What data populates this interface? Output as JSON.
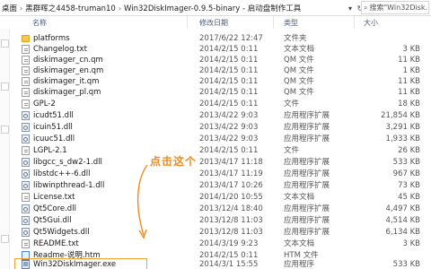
{
  "address_bar": {
    "segments": [
      "桌面",
      "黑群晖之4458-truman10",
      "Win32DiskImager-0.9.5-binary - 启动盘制作工具"
    ],
    "search_placeholder": "搜索\"Win32Disk..."
  },
  "columns": {
    "name": "名称",
    "date": "修改日期",
    "type": "类型",
    "size": "大小"
  },
  "files": [
    {
      "name": "platforms",
      "date": "2017/6/22 12:47",
      "type": "文件夹",
      "size": "",
      "icon": "folder-icon"
    },
    {
      "name": "Changelog.txt",
      "date": "2014/2/15 0:11",
      "type": "文本文档",
      "size": "3 KB",
      "icon": "text-file-icon"
    },
    {
      "name": "diskimager_cn.qm",
      "date": "2014/2/15 0:11",
      "type": "QM 文件",
      "size": "11 KB",
      "icon": "file-icon"
    },
    {
      "name": "diskimager_en.qm",
      "date": "2014/2/15 0:11",
      "type": "QM 文件",
      "size": "1 KB",
      "icon": "file-icon"
    },
    {
      "name": "diskimager_it.qm",
      "date": "2014/2/15 0:11",
      "type": "QM 文件",
      "size": "11 KB",
      "icon": "file-icon"
    },
    {
      "name": "diskimager_pl.qm",
      "date": "2014/2/15 0:11",
      "type": "QM 文件",
      "size": "11 KB",
      "icon": "file-icon"
    },
    {
      "name": "GPL-2",
      "date": "2014/2/15 0:11",
      "type": "文件",
      "size": "18 KB",
      "icon": "file-icon"
    },
    {
      "name": "icudt51.dll",
      "date": "2013/4/22 9:03",
      "type": "应用程序扩展",
      "size": "21,854 KB",
      "icon": "dll-icon"
    },
    {
      "name": "icuin51.dll",
      "date": "2013/4/22 9:03",
      "type": "应用程序扩展",
      "size": "3,291 KB",
      "icon": "dll-icon"
    },
    {
      "name": "icuuc51.dll",
      "date": "2013/4/22 9:03",
      "type": "应用程序扩展",
      "size": "1,933 KB",
      "icon": "dll-icon"
    },
    {
      "name": "LGPL-2.1",
      "date": "2014/2/15 0:11",
      "type": "文件",
      "size": "26 KB",
      "icon": "file-icon"
    },
    {
      "name": "libgcc_s_dw2-1.dll",
      "date": "2013/4/17 11:18",
      "type": "应用程序扩展",
      "size": "533 KB",
      "icon": "dll-icon"
    },
    {
      "name": "libstdc++-6.dll",
      "date": "2013/4/17 11:19",
      "type": "应用程序扩展",
      "size": "967 KB",
      "icon": "dll-icon"
    },
    {
      "name": "libwinpthread-1.dll",
      "date": "2013/4/17 10:26",
      "type": "应用程序扩展",
      "size": "73 KB",
      "icon": "dll-icon"
    },
    {
      "name": "License.txt",
      "date": "2014/1/20 10:55",
      "type": "文本文档",
      "size": "45 KB",
      "icon": "text-file-icon"
    },
    {
      "name": "Qt5Core.dll",
      "date": "2013/12/4 18:40",
      "type": "应用程序扩展",
      "size": "4,497 KB",
      "icon": "dll-icon"
    },
    {
      "name": "Qt5Gui.dll",
      "date": "2013/12/8 11:03",
      "type": "应用程序扩展",
      "size": "4,514 KB",
      "icon": "dll-icon"
    },
    {
      "name": "Qt5Widgets.dll",
      "date": "2013/12/8 11:03",
      "type": "应用程序扩展",
      "size": "6,134 KB",
      "icon": "dll-icon"
    },
    {
      "name": "README.txt",
      "date": "2014/3/19 9:23",
      "type": "文本文档",
      "size": "3 KB",
      "icon": "text-file-icon"
    },
    {
      "name": "Readme-说明.htm",
      "date": "2014/2/15 0:11",
      "type": "HTM 文件",
      "size": "",
      "icon": "htm-file-icon"
    },
    {
      "name": "Win32DiskImager.exe",
      "date": "2014/3/1 15:55",
      "type": "应用程序",
      "size": "533 KB",
      "icon": "exe-icon"
    }
  ],
  "annotation": {
    "text": "点击这个",
    "color": "#f08a1e"
  },
  "selected_file": "Win32DiskImager.exe"
}
